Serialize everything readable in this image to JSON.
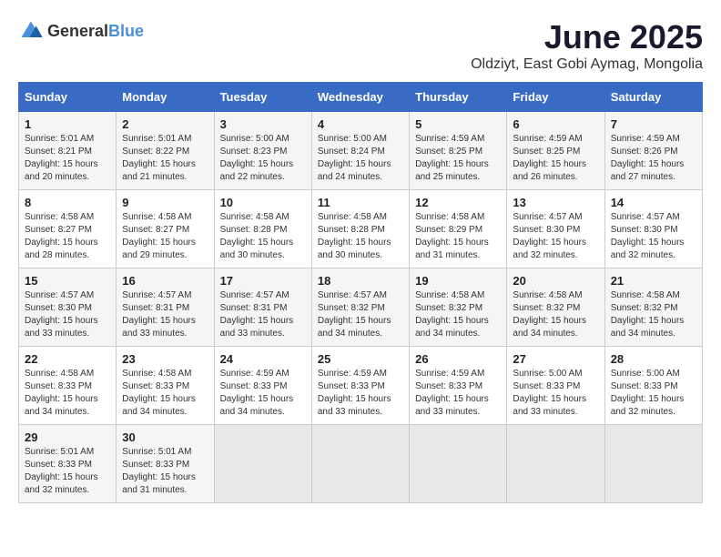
{
  "logo": {
    "general": "General",
    "blue": "Blue"
  },
  "title": "June 2025",
  "subtitle": "Oldziyt, East Gobi Aymag, Mongolia",
  "headers": [
    "Sunday",
    "Monday",
    "Tuesday",
    "Wednesday",
    "Thursday",
    "Friday",
    "Saturday"
  ],
  "weeks": [
    [
      {
        "num": "1",
        "sunrise": "5:01 AM",
        "sunset": "8:21 PM",
        "daylight": "15 hours and 20 minutes."
      },
      {
        "num": "2",
        "sunrise": "5:01 AM",
        "sunset": "8:22 PM",
        "daylight": "15 hours and 21 minutes."
      },
      {
        "num": "3",
        "sunrise": "5:00 AM",
        "sunset": "8:23 PM",
        "daylight": "15 hours and 22 minutes."
      },
      {
        "num": "4",
        "sunrise": "5:00 AM",
        "sunset": "8:24 PM",
        "daylight": "15 hours and 24 minutes."
      },
      {
        "num": "5",
        "sunrise": "4:59 AM",
        "sunset": "8:25 PM",
        "daylight": "15 hours and 25 minutes."
      },
      {
        "num": "6",
        "sunrise": "4:59 AM",
        "sunset": "8:25 PM",
        "daylight": "15 hours and 26 minutes."
      },
      {
        "num": "7",
        "sunrise": "4:59 AM",
        "sunset": "8:26 PM",
        "daylight": "15 hours and 27 minutes."
      }
    ],
    [
      {
        "num": "8",
        "sunrise": "4:58 AM",
        "sunset": "8:27 PM",
        "daylight": "15 hours and 28 minutes."
      },
      {
        "num": "9",
        "sunrise": "4:58 AM",
        "sunset": "8:27 PM",
        "daylight": "15 hours and 29 minutes."
      },
      {
        "num": "10",
        "sunrise": "4:58 AM",
        "sunset": "8:28 PM",
        "daylight": "15 hours and 30 minutes."
      },
      {
        "num": "11",
        "sunrise": "4:58 AM",
        "sunset": "8:28 PM",
        "daylight": "15 hours and 30 minutes."
      },
      {
        "num": "12",
        "sunrise": "4:58 AM",
        "sunset": "8:29 PM",
        "daylight": "15 hours and 31 minutes."
      },
      {
        "num": "13",
        "sunrise": "4:57 AM",
        "sunset": "8:30 PM",
        "daylight": "15 hours and 32 minutes."
      },
      {
        "num": "14",
        "sunrise": "4:57 AM",
        "sunset": "8:30 PM",
        "daylight": "15 hours and 32 minutes."
      }
    ],
    [
      {
        "num": "15",
        "sunrise": "4:57 AM",
        "sunset": "8:30 PM",
        "daylight": "15 hours and 33 minutes."
      },
      {
        "num": "16",
        "sunrise": "4:57 AM",
        "sunset": "8:31 PM",
        "daylight": "15 hours and 33 minutes."
      },
      {
        "num": "17",
        "sunrise": "4:57 AM",
        "sunset": "8:31 PM",
        "daylight": "15 hours and 33 minutes."
      },
      {
        "num": "18",
        "sunrise": "4:57 AM",
        "sunset": "8:32 PM",
        "daylight": "15 hours and 34 minutes."
      },
      {
        "num": "19",
        "sunrise": "4:58 AM",
        "sunset": "8:32 PM",
        "daylight": "15 hours and 34 minutes."
      },
      {
        "num": "20",
        "sunrise": "4:58 AM",
        "sunset": "8:32 PM",
        "daylight": "15 hours and 34 minutes."
      },
      {
        "num": "21",
        "sunrise": "4:58 AM",
        "sunset": "8:32 PM",
        "daylight": "15 hours and 34 minutes."
      }
    ],
    [
      {
        "num": "22",
        "sunrise": "4:58 AM",
        "sunset": "8:33 PM",
        "daylight": "15 hours and 34 minutes."
      },
      {
        "num": "23",
        "sunrise": "4:58 AM",
        "sunset": "8:33 PM",
        "daylight": "15 hours and 34 minutes."
      },
      {
        "num": "24",
        "sunrise": "4:59 AM",
        "sunset": "8:33 PM",
        "daylight": "15 hours and 34 minutes."
      },
      {
        "num": "25",
        "sunrise": "4:59 AM",
        "sunset": "8:33 PM",
        "daylight": "15 hours and 33 minutes."
      },
      {
        "num": "26",
        "sunrise": "4:59 AM",
        "sunset": "8:33 PM",
        "daylight": "15 hours and 33 minutes."
      },
      {
        "num": "27",
        "sunrise": "5:00 AM",
        "sunset": "8:33 PM",
        "daylight": "15 hours and 33 minutes."
      },
      {
        "num": "28",
        "sunrise": "5:00 AM",
        "sunset": "8:33 PM",
        "daylight": "15 hours and 32 minutes."
      }
    ],
    [
      {
        "num": "29",
        "sunrise": "5:01 AM",
        "sunset": "8:33 PM",
        "daylight": "15 hours and 32 minutes."
      },
      {
        "num": "30",
        "sunrise": "5:01 AM",
        "sunset": "8:33 PM",
        "daylight": "15 hours and 31 minutes."
      },
      null,
      null,
      null,
      null,
      null
    ]
  ]
}
